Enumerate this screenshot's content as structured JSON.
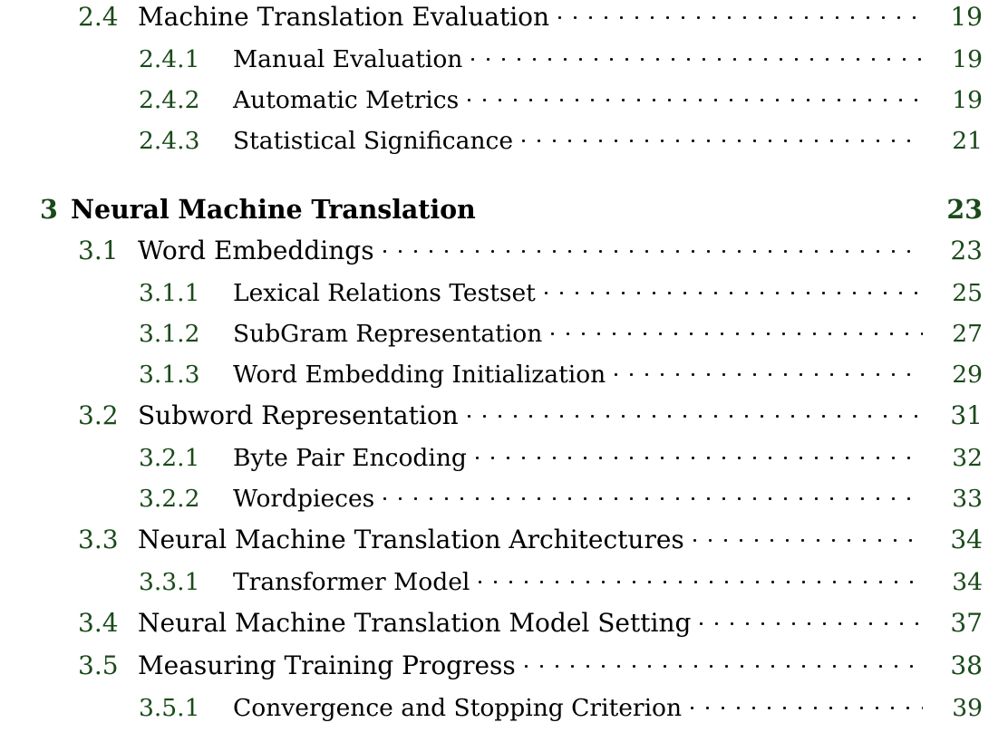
{
  "document": {
    "kind": "table-of-contents",
    "page_background": "#ffffff",
    "number_color": "#1a4a1a",
    "title_color": "#000000",
    "leader_color": "#111111"
  },
  "entries": [
    {
      "level": "subsection",
      "number": "2.4",
      "title": "Machine Translation Evaluation",
      "page": "19",
      "display_level": "section",
      "leader": true,
      "gap_before": false
    },
    {
      "level": "subsection",
      "number": "2.4.1",
      "title": "Manual Evaluation",
      "page": "19",
      "display_level": "subsection",
      "leader": true,
      "gap_before": false
    },
    {
      "level": "subsection",
      "number": "2.4.2",
      "title": "Automatic Metrics",
      "page": "19",
      "display_level": "subsection",
      "leader": true,
      "gap_before": false
    },
    {
      "level": "subsection",
      "number": "2.4.3",
      "title": "Statistical Significance",
      "page": "21",
      "display_level": "subsection",
      "leader": true,
      "gap_before": false
    },
    {
      "level": "chapter",
      "number": "3",
      "title": "Neural Machine Translation",
      "page": "23",
      "display_level": "chapter",
      "leader": false,
      "gap_before": true
    },
    {
      "level": "section",
      "number": "3.1",
      "title": "Word Embeddings",
      "page": "23",
      "display_level": "section",
      "leader": true,
      "gap_before": false
    },
    {
      "level": "subsection",
      "number": "3.1.1",
      "title": "Lexical Relations Testset",
      "page": "25",
      "display_level": "subsection",
      "leader": true,
      "gap_before": false
    },
    {
      "level": "subsection",
      "number": "3.1.2",
      "title": "SubGram Representation",
      "page": "27",
      "display_level": "subsection",
      "leader": true,
      "gap_before": false
    },
    {
      "level": "subsection",
      "number": "3.1.3",
      "title": "Word Embedding Initialization",
      "page": "29",
      "display_level": "subsection",
      "leader": true,
      "gap_before": false
    },
    {
      "level": "section",
      "number": "3.2",
      "title": "Subword Representation",
      "page": "31",
      "display_level": "section",
      "leader": true,
      "gap_before": false
    },
    {
      "level": "subsection",
      "number": "3.2.1",
      "title": "Byte Pair Encoding",
      "page": "32",
      "display_level": "subsection",
      "leader": true,
      "gap_before": false
    },
    {
      "level": "subsection",
      "number": "3.2.2",
      "title": "Wordpieces",
      "page": "33",
      "display_level": "subsection",
      "leader": true,
      "gap_before": false
    },
    {
      "level": "section",
      "number": "3.3",
      "title": "Neural Machine Translation Architectures",
      "page": "34",
      "display_level": "section",
      "leader": true,
      "gap_before": false
    },
    {
      "level": "subsection",
      "number": "3.3.1",
      "title": "Transformer Model",
      "page": "34",
      "display_level": "subsection",
      "leader": true,
      "gap_before": false
    },
    {
      "level": "section",
      "number": "3.4",
      "title": "Neural Machine Translation Model Setting",
      "page": "37",
      "display_level": "section",
      "leader": true,
      "gap_before": false
    },
    {
      "level": "section",
      "number": "3.5",
      "title": "Measuring Training Progress",
      "page": "38",
      "display_level": "section",
      "leader": true,
      "gap_before": false
    },
    {
      "level": "subsection",
      "number": "3.5.1",
      "title": "Convergence and Stopping Criterion",
      "page": "39",
      "display_level": "subsection",
      "leader": true,
      "gap_before": false
    }
  ]
}
